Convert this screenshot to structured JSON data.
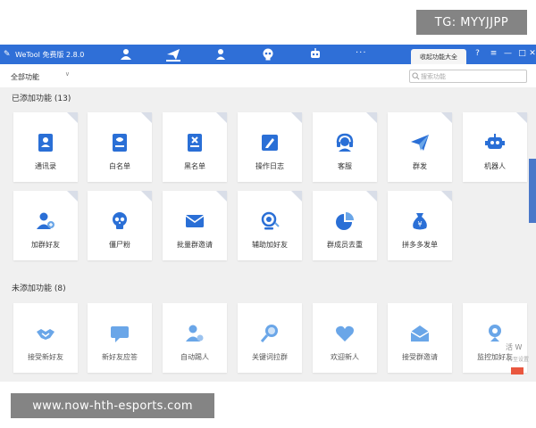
{
  "app": {
    "title": "WeTool 免费版 2.8.0",
    "favorites_tab": "收起功能大全",
    "more": "···",
    "win_controls": [
      "?",
      "≡",
      "—",
      "□",
      "✕"
    ]
  },
  "nav_icons": [
    "contacts-icon",
    "send-icon",
    "user-icon",
    "skull-icon",
    "robot-icon"
  ],
  "toolbar": {
    "filter_value": "全部功能",
    "search_placeholder": "搜索功能"
  },
  "added": {
    "title": "已添加功能 (13)",
    "items": [
      {
        "label": "通讯录",
        "icon": "contact-book-icon"
      },
      {
        "label": "白名单",
        "icon": "whitelist-icon"
      },
      {
        "label": "黑名单",
        "icon": "blacklist-icon"
      },
      {
        "label": "操作日志",
        "icon": "log-icon"
      },
      {
        "label": "客服",
        "icon": "headset-icon"
      },
      {
        "label": "群发",
        "icon": "paper-plane-icon"
      },
      {
        "label": "机器人",
        "icon": "robot-icon"
      },
      {
        "label": "加群好友",
        "icon": "add-friend-icon"
      },
      {
        "label": "僵尸粉",
        "icon": "skull-icon"
      },
      {
        "label": "批量群邀请",
        "icon": "mail-icon"
      },
      {
        "label": "辅助加好友",
        "icon": "target-icon"
      },
      {
        "label": "群成员去重",
        "icon": "pie-chart-icon"
      },
      {
        "label": "拼多多发单",
        "icon": "money-bag-icon"
      }
    ]
  },
  "not_added": {
    "title": "未添加功能 (8)",
    "items": [
      {
        "label": "接受新好友",
        "icon": "handshake-icon"
      },
      {
        "label": "新好友应答",
        "icon": "chat-bubble-icon"
      },
      {
        "label": "自动踢人",
        "icon": "kick-user-icon"
      },
      {
        "label": "关键词拉群",
        "icon": "magnifier-icon"
      },
      {
        "label": "欢迎新人",
        "icon": "heart-icon"
      },
      {
        "label": "接受群邀请",
        "icon": "open-mail-icon"
      },
      {
        "label": "监控加好友",
        "icon": "webcam-icon"
      }
    ]
  },
  "overlays": {
    "tg": "TG: MYYJJPP",
    "url": "www.now-hth-esports.com",
    "edge_text": "活 W",
    "edge_text2": "转至设置"
  },
  "colors": {
    "titlebar": "#2f6fd7",
    "icon_blue": "#2a6fd6",
    "icon_light": "#6aa6e8",
    "background": "#f0f0f0"
  }
}
